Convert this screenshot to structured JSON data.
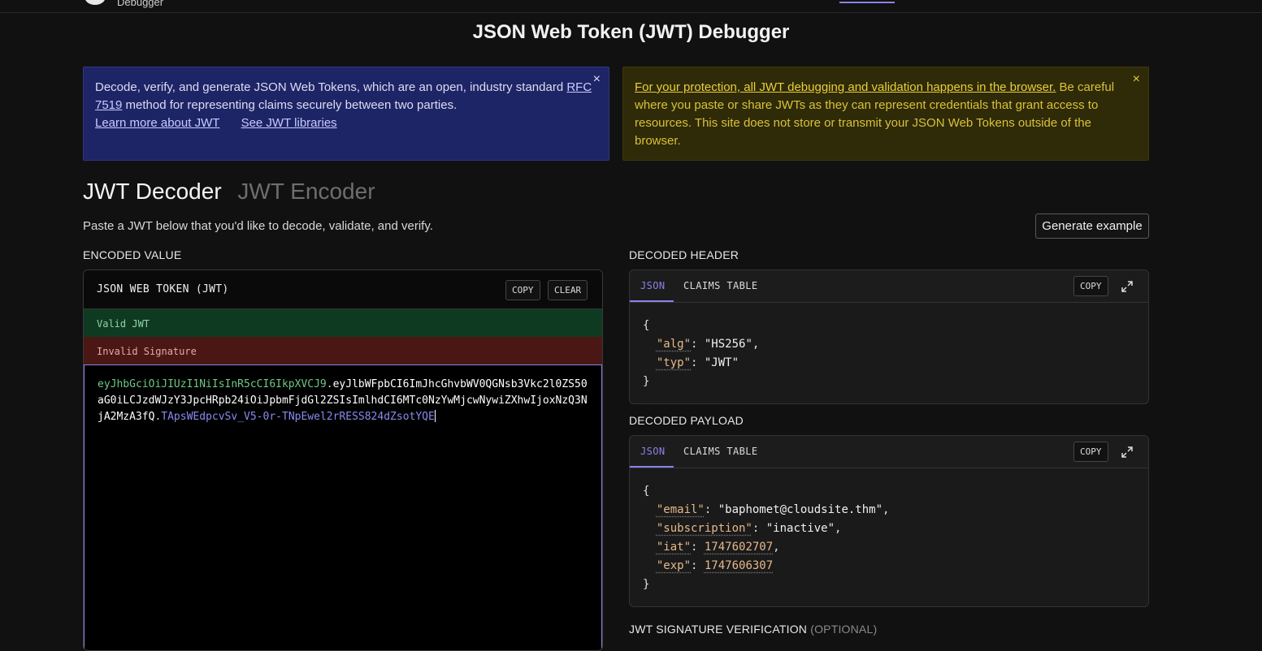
{
  "topbar": {
    "brand_sub": "Debugger"
  },
  "page_title": "JSON Web Token (JWT) Debugger",
  "banners": {
    "info": {
      "text1": "Decode, verify, and generate JSON Web Tokens, which are an open, industry standard",
      "rfc_link": "RFC 7519",
      "text2": " method for representing claims securely between two parties.",
      "learn_link": "Learn more about JWT",
      "libs_link": "See JWT libraries",
      "close": "×"
    },
    "warn": {
      "link": "For your protection, all JWT debugging and validation happens in the browser.",
      "text": " Be careful where you paste or share JWTs as they can represent credentials that grant access to resources. This site does not store or transmit your JSON Web Tokens outside of the browser.",
      "close": "×"
    }
  },
  "mode_tabs": {
    "decoder": "JWT Decoder",
    "encoder": "JWT Encoder"
  },
  "hint": "Paste a JWT below that you'd like to decode, validate, and verify.",
  "generate_button": "Generate example",
  "encoded": {
    "section_label": "ENCODED VALUE",
    "panel_title": "JSON WEB TOKEN (JWT)",
    "copy": "COPY",
    "clear": "CLEAR",
    "status_valid": "Valid JWT",
    "status_invalid": "Invalid Signature",
    "token_header": "eyJhbGciOiJIUzI1NiIsInR5cCI6IkpXVCJ9",
    "token_payload": "eyJlbWFpbCI6ImJhcGhvbWV0QGNsb3Vkc2l0ZS50aG0iLCJzdWJzY3JpcHRpb24iOiJpbmFjdGl2ZSIsImlhdCI6MTc0NzYwMjcwNywiZXhwIjoxNzQ3NjA2MzA3fQ",
    "token_signature": "TApsWEdpcvSv_V5-0r-TNpEwel2rRESS824dZsotYQE",
    "dot": "."
  },
  "decoded_header": {
    "section_label": "DECODED HEADER",
    "tab_json": "JSON",
    "tab_claims": "CLAIMS TABLE",
    "copy": "COPY",
    "open": "{",
    "close": "}",
    "fields": [
      {
        "key": "\"alg\"",
        "value": "\"HS256\"",
        "trail": ","
      },
      {
        "key": "\"typ\"",
        "value": "\"JWT\"",
        "trail": ""
      }
    ]
  },
  "decoded_payload": {
    "section_label": "DECODED PAYLOAD",
    "tab_json": "JSON",
    "tab_claims": "CLAIMS TABLE",
    "copy": "COPY",
    "open": "{",
    "close": "}",
    "fields": [
      {
        "key": "\"email\"",
        "value": "\"baphomet@cloudsite.thm\"",
        "trail": ",",
        "kind": "s"
      },
      {
        "key": "\"subscription\"",
        "value": "\"inactive\"",
        "trail": ",",
        "kind": "s"
      },
      {
        "key": "\"iat\"",
        "value": "1747602707",
        "trail": ",",
        "kind": "n"
      },
      {
        "key": "\"exp\"",
        "value": "1747606307",
        "trail": "",
        "kind": "n"
      }
    ]
  },
  "signature_verification": {
    "label": "JWT SIGNATURE VERIFICATION",
    "optional": "(OPTIONAL)"
  }
}
